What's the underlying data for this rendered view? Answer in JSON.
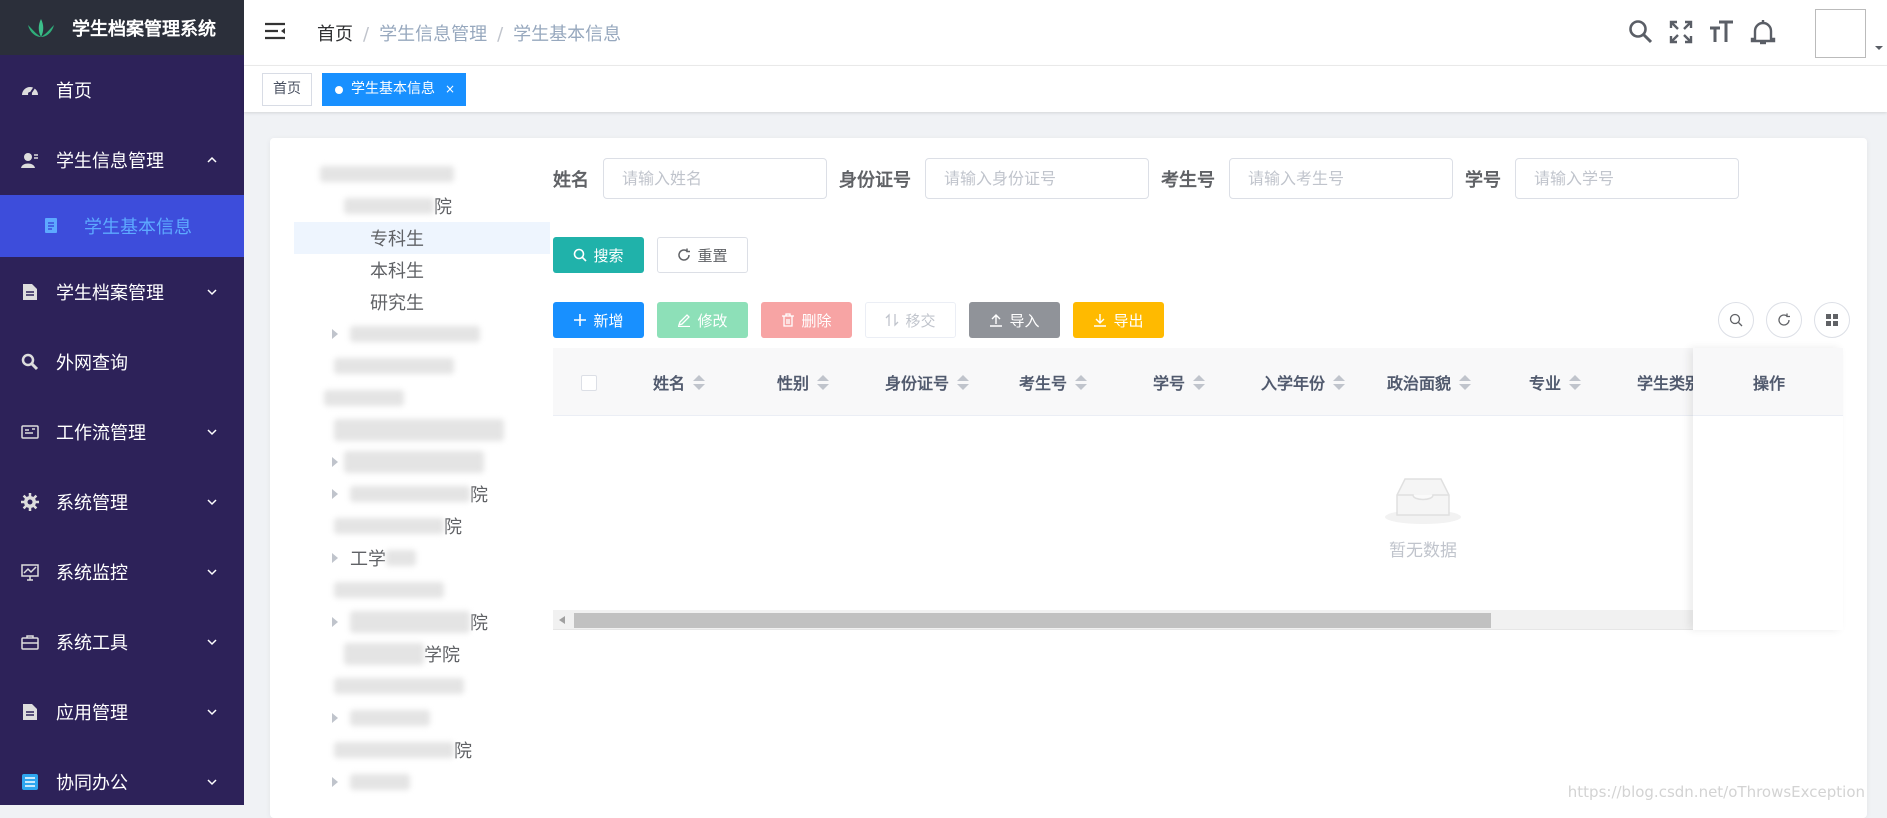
{
  "sidebar": {
    "app_title": "学生档案管理系统",
    "items": [
      {
        "label": "首页",
        "icon": "dashboard-icon"
      },
      {
        "label": "学生信息管理",
        "icon": "user-icon",
        "expanded": true
      },
      {
        "label": "学生基本信息",
        "icon": "form-icon",
        "sub": true,
        "active": true
      },
      {
        "label": "学生档案管理",
        "icon": "document-icon"
      },
      {
        "label": "外网查询",
        "icon": "search-icon"
      },
      {
        "label": "工作流管理",
        "icon": "workflow-icon"
      },
      {
        "label": "系统管理",
        "icon": "gear-icon"
      },
      {
        "label": "系统监控",
        "icon": "monitor-icon"
      },
      {
        "label": "系统工具",
        "icon": "toolbox-icon"
      },
      {
        "label": "应用管理",
        "icon": "app-icon"
      },
      {
        "label": "协同办公",
        "icon": "office-icon"
      }
    ]
  },
  "navbar": {
    "breadcrumb": [
      "首页",
      "学生信息管理",
      "学生基本信息"
    ]
  },
  "tags": [
    {
      "label": "首页"
    },
    {
      "label": "学生基本信息",
      "close": "×"
    }
  ],
  "tree": {
    "nodes": [
      "专科生",
      "本科生",
      "研究生",
      "院",
      "院",
      "院",
      "工学",
      "院",
      "院",
      "学院"
    ]
  },
  "search": {
    "name_label": "姓名",
    "name_placeholder": "请输入姓名",
    "idcard_label": "身份证号",
    "idcard_placeholder": "请输入身份证号",
    "examno_label": "考生号",
    "examno_placeholder": "请输入考生号",
    "studentno_label": "学号",
    "studentno_placeholder": "请输入学号",
    "search_btn": "搜索",
    "reset_btn": "重置"
  },
  "toolbar": {
    "add": "新增",
    "edit": "修改",
    "delete": "删除",
    "transfer": "移交",
    "import": "导入",
    "export": "导出"
  },
  "table": {
    "columns": [
      "姓名",
      "性别",
      "身份证号",
      "考生号",
      "学号",
      "入学年份",
      "政治面貌",
      "专业",
      "学生类别"
    ],
    "action_column": "操作",
    "empty_text": "暂无数据"
  },
  "watermark": "https://blog.csdn.net/oThrowsException",
  "colors": {
    "sidebar_bg": "#2d2259",
    "active_menu": "#3d4ddb",
    "primary": "#1890ff",
    "search_btn": "#20b2aa",
    "edit_btn": "#8de0b8",
    "delete_btn": "#f7a4a4",
    "import_btn": "#909399",
    "export_btn": "#ffba00"
  }
}
